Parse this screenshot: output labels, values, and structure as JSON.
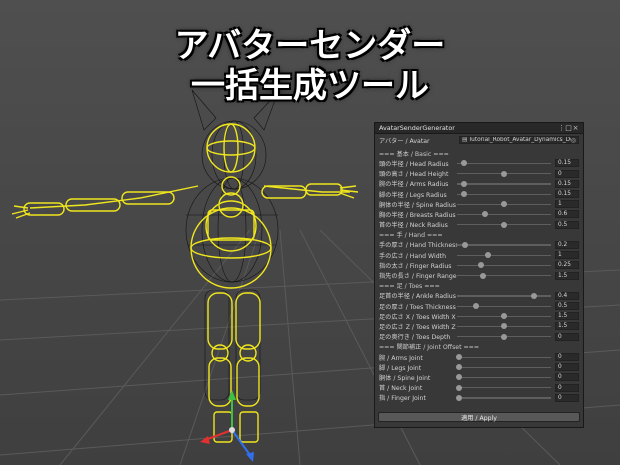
{
  "headline": {
    "line1": "アバターセンダー",
    "line2": "一括生成ツール"
  },
  "window": {
    "title": "AvatarSenderGenerator"
  },
  "avatar_field": {
    "label": "アバター / Avatar",
    "value": "Tutorial_Robot_Avatar_Dynamics_Dem",
    "icon": "avatar-asset-icon"
  },
  "sections": [
    {
      "header": "=== 基本 / Basic ===",
      "fields": [
        {
          "label": "頭の半径 / Head Radius",
          "value": "0.15",
          "fraction": 0.07
        },
        {
          "label": "頭の高さ / Head Height",
          "value": "0",
          "fraction": 0.5
        },
        {
          "label": "腕の半径 / Arms Radius",
          "value": "0.15",
          "fraction": 0.07
        },
        {
          "label": "脚の半径 / Legs Radius",
          "value": "0.15",
          "fraction": 0.07
        },
        {
          "label": "胴体の半径 / Spine Radius",
          "value": "1",
          "fraction": 0.5
        },
        {
          "label": "胸の半径 / Breasts Radius",
          "value": "0.6",
          "fraction": 0.3
        },
        {
          "label": "首の半径 / Neck Radius",
          "value": "0.5",
          "fraction": 0.5
        }
      ]
    },
    {
      "header": "=== 手 / Hand ===",
      "fields": [
        {
          "label": "手の厚さ / Hand Thickness",
          "value": "0.2",
          "fraction": 0.09
        },
        {
          "label": "手の広さ / Hand Width",
          "value": "1",
          "fraction": 0.33
        },
        {
          "label": "指の太さ / Finger Radius",
          "value": "0.25",
          "fraction": 0.25
        },
        {
          "label": "指先の長さ / Finger Range",
          "value": "1.5",
          "fraction": 0.28
        }
      ]
    },
    {
      "header": "=== 足 / Toes ===",
      "fields": [
        {
          "label": "足首の半径 / Ankle Radius",
          "value": "0.4",
          "fraction": 0.82
        },
        {
          "label": "足の厚さ / Toes Thickness",
          "value": "0.5",
          "fraction": 0.2
        },
        {
          "label": "足の広さ X / Toes Width X",
          "value": "1.5",
          "fraction": 0.5
        },
        {
          "label": "足の広さ Z / Toes Width Z",
          "value": "1.5",
          "fraction": 0.5
        },
        {
          "label": "足の奥行き / Toes Depth",
          "value": "0",
          "fraction": 0.5
        }
      ]
    },
    {
      "header": "=== 関節補正 / Joint Offset ===",
      "fields": [
        {
          "label": "腕 / Arms Joint",
          "value": "0",
          "fraction": 0.0
        },
        {
          "label": "脚 / Legs Joint",
          "value": "0",
          "fraction": 0.0
        },
        {
          "label": "胴体 / Spine Joint",
          "value": "0",
          "fraction": 0.0
        },
        {
          "label": "首 / Neck Joint",
          "value": "0",
          "fraction": 0.0
        },
        {
          "label": "指 / Finger Joint",
          "value": "0",
          "fraction": 0.0
        }
      ]
    }
  ],
  "apply_button": {
    "label": "適用 / Apply"
  },
  "colors": {
    "gizmo": "#f0e61e",
    "mesh": "#0a0a0a",
    "panel": "#383838",
    "axis_x": "#e03030",
    "axis_y": "#40c040",
    "axis_z": "#3070f0"
  }
}
